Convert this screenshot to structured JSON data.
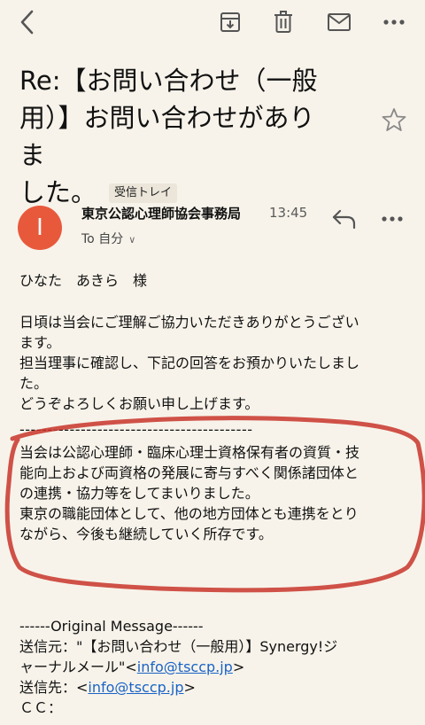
{
  "toolbar": {
    "back_icon": "back-chevron-icon",
    "archive_icon": "archive-icon",
    "delete_icon": "trash-icon",
    "mail_icon": "mail-icon",
    "more_icon": "more-horizontal-icon"
  },
  "subject": {
    "lines": [
      "Re:【お問い合わせ（一般",
      "用）】お問い合わせがありま",
      "した。"
    ],
    "label": "受信トレイ"
  },
  "message": {
    "avatar_letter": "I",
    "avatar_color": "#e8593c",
    "sender": "東京公認心理師協会事務局",
    "time": "13:45",
    "to": "To 自分",
    "to_chevron": "∨"
  },
  "body": {
    "salutation": "ひなた　あきら　様",
    "para1": [
      "日頃は当会にご理解ご協力いただきありがとうござい",
      "ます。",
      "担当理事に確認し、下記の回答をお預かりいたしまし",
      "た。",
      "どうぞよろしくお願い申し上げます。"
    ],
    "divider": "------------------------------------------",
    "para2": [
      "当会は公認心理師・臨床心理士資格保有者の資質・技",
      "能向上および両資格の発展に寄与すべく関係諸団体と",
      "の連携・協力等をしてまいりました。",
      "東京の職能団体として、他の地方団体とも連携をとり",
      "ながら、今後も継続していく所存です。"
    ],
    "original_header": "------Original Message------",
    "from_prefix": "送信元：\"【お問い合わせ（一般用）】Synergy!ジ",
    "from_line2_prefix": "ャーナルメール\"<",
    "from_email": "info@tsccp.jp",
    "from_line2_suffix": ">",
    "to_prefix": "送信先：<",
    "to_email": "info@tsccp.jp",
    "to_suffix": ">",
    "cc": "ＣＣ："
  },
  "colors": {
    "background": "#f7f3ea",
    "highlight_ring": "#c8342a",
    "link": "#1a63c7"
  }
}
